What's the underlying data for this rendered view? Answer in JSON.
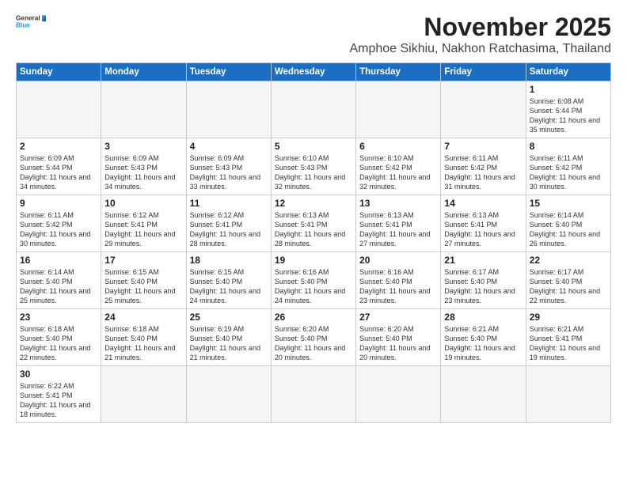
{
  "header": {
    "month_year": "November 2025",
    "location": "Amphoe Sikhiu, Nakhon Ratchasima, Thailand",
    "logo_general": "General",
    "logo_blue": "Blue"
  },
  "days_of_week": [
    "Sunday",
    "Monday",
    "Tuesday",
    "Wednesday",
    "Thursday",
    "Friday",
    "Saturday"
  ],
  "weeks": [
    [
      {
        "day": "",
        "empty": true
      },
      {
        "day": "",
        "empty": true
      },
      {
        "day": "",
        "empty": true
      },
      {
        "day": "",
        "empty": true
      },
      {
        "day": "",
        "empty": true
      },
      {
        "day": "",
        "empty": true
      },
      {
        "day": "1",
        "sunrise": "6:08 AM",
        "sunset": "5:44 PM",
        "daylight": "11 hours and 35 minutes."
      }
    ],
    [
      {
        "day": "2",
        "sunrise": "6:09 AM",
        "sunset": "5:44 PM",
        "daylight": "11 hours and 34 minutes."
      },
      {
        "day": "3",
        "sunrise": "6:09 AM",
        "sunset": "5:43 PM",
        "daylight": "11 hours and 34 minutes."
      },
      {
        "day": "4",
        "sunrise": "6:09 AM",
        "sunset": "5:43 PM",
        "daylight": "11 hours and 33 minutes."
      },
      {
        "day": "5",
        "sunrise": "6:10 AM",
        "sunset": "5:43 PM",
        "daylight": "11 hours and 32 minutes."
      },
      {
        "day": "6",
        "sunrise": "6:10 AM",
        "sunset": "5:42 PM",
        "daylight": "11 hours and 32 minutes."
      },
      {
        "day": "7",
        "sunrise": "6:11 AM",
        "sunset": "5:42 PM",
        "daylight": "11 hours and 31 minutes."
      },
      {
        "day": "8",
        "sunrise": "6:11 AM",
        "sunset": "5:42 PM",
        "daylight": "11 hours and 30 minutes."
      }
    ],
    [
      {
        "day": "9",
        "sunrise": "6:11 AM",
        "sunset": "5:42 PM",
        "daylight": "11 hours and 30 minutes."
      },
      {
        "day": "10",
        "sunrise": "6:12 AM",
        "sunset": "5:41 PM",
        "daylight": "11 hours and 29 minutes."
      },
      {
        "day": "11",
        "sunrise": "6:12 AM",
        "sunset": "5:41 PM",
        "daylight": "11 hours and 28 minutes."
      },
      {
        "day": "12",
        "sunrise": "6:13 AM",
        "sunset": "5:41 PM",
        "daylight": "11 hours and 28 minutes."
      },
      {
        "day": "13",
        "sunrise": "6:13 AM",
        "sunset": "5:41 PM",
        "daylight": "11 hours and 27 minutes."
      },
      {
        "day": "14",
        "sunrise": "6:13 AM",
        "sunset": "5:41 PM",
        "daylight": "11 hours and 27 minutes."
      },
      {
        "day": "15",
        "sunrise": "6:14 AM",
        "sunset": "5:40 PM",
        "daylight": "11 hours and 26 minutes."
      }
    ],
    [
      {
        "day": "16",
        "sunrise": "6:14 AM",
        "sunset": "5:40 PM",
        "daylight": "11 hours and 25 minutes."
      },
      {
        "day": "17",
        "sunrise": "6:15 AM",
        "sunset": "5:40 PM",
        "daylight": "11 hours and 25 minutes."
      },
      {
        "day": "18",
        "sunrise": "6:15 AM",
        "sunset": "5:40 PM",
        "daylight": "11 hours and 24 minutes."
      },
      {
        "day": "19",
        "sunrise": "6:16 AM",
        "sunset": "5:40 PM",
        "daylight": "11 hours and 24 minutes."
      },
      {
        "day": "20",
        "sunrise": "6:16 AM",
        "sunset": "5:40 PM",
        "daylight": "11 hours and 23 minutes."
      },
      {
        "day": "21",
        "sunrise": "6:17 AM",
        "sunset": "5:40 PM",
        "daylight": "11 hours and 23 minutes."
      },
      {
        "day": "22",
        "sunrise": "6:17 AM",
        "sunset": "5:40 PM",
        "daylight": "11 hours and 22 minutes."
      }
    ],
    [
      {
        "day": "23",
        "sunrise": "6:18 AM",
        "sunset": "5:40 PM",
        "daylight": "11 hours and 22 minutes."
      },
      {
        "day": "24",
        "sunrise": "6:18 AM",
        "sunset": "5:40 PM",
        "daylight": "11 hours and 21 minutes."
      },
      {
        "day": "25",
        "sunrise": "6:19 AM",
        "sunset": "5:40 PM",
        "daylight": "11 hours and 21 minutes."
      },
      {
        "day": "26",
        "sunrise": "6:20 AM",
        "sunset": "5:40 PM",
        "daylight": "11 hours and 20 minutes."
      },
      {
        "day": "27",
        "sunrise": "6:20 AM",
        "sunset": "5:40 PM",
        "daylight": "11 hours and 20 minutes."
      },
      {
        "day": "28",
        "sunrise": "6:21 AM",
        "sunset": "5:40 PM",
        "daylight": "11 hours and 19 minutes."
      },
      {
        "day": "29",
        "sunrise": "6:21 AM",
        "sunset": "5:41 PM",
        "daylight": "11 hours and 19 minutes."
      }
    ],
    [
      {
        "day": "30",
        "sunrise": "6:22 AM",
        "sunset": "5:41 PM",
        "daylight": "11 hours and 18 minutes."
      },
      {
        "day": "",
        "empty": true
      },
      {
        "day": "",
        "empty": true
      },
      {
        "day": "",
        "empty": true
      },
      {
        "day": "",
        "empty": true
      },
      {
        "day": "",
        "empty": true
      },
      {
        "day": "",
        "empty": true
      }
    ]
  ],
  "labels": {
    "sunrise": "Sunrise:",
    "sunset": "Sunset:",
    "daylight": "Daylight:"
  },
  "colors": {
    "header_bg": "#1a6fc4",
    "logo_blue": "#1a9ad7"
  }
}
